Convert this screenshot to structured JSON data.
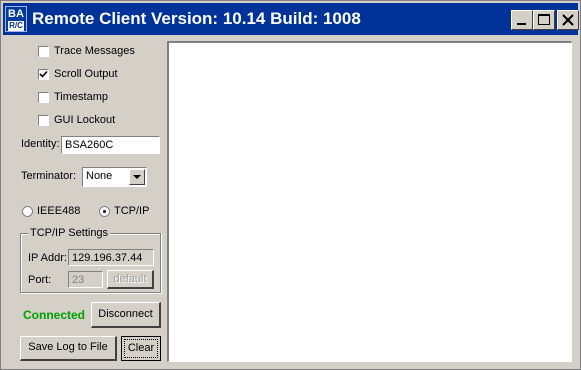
{
  "window": {
    "title": "Remote Client Version: 10.14 Build: 1008",
    "icon": {
      "top": "BA",
      "bottom": "R/C"
    },
    "controls": {
      "minimize": "minimize-icon",
      "maximize": "maximize-icon",
      "close": "close-icon"
    }
  },
  "options": {
    "trace_messages": {
      "label": "Trace Messages",
      "checked": false
    },
    "scroll_output": {
      "label": "Scroll Output",
      "checked": true
    },
    "timestamp": {
      "label": "Timestamp",
      "checked": false
    },
    "gui_lockout": {
      "label": "GUI Lockout",
      "checked": false
    }
  },
  "identity": {
    "label": "Identity:",
    "value": "BSA260C"
  },
  "terminator": {
    "label": "Terminator:",
    "selected": "None"
  },
  "interface": {
    "ieee488": {
      "label": "IEEE488",
      "selected": false
    },
    "tcpip": {
      "label": "TCP/IP",
      "selected": true
    }
  },
  "tcpip_settings": {
    "title": "TCP/IP Settings",
    "ip_label": "IP Addr:",
    "ip_value": "129.196.37.44",
    "port_label": "Port:",
    "port_value": "23",
    "default_label": "default"
  },
  "status": {
    "text": "Connected",
    "color": "#00a000"
  },
  "buttons": {
    "disconnect": "Disconnect",
    "save_log": "Save Log to File",
    "clear": "Clear"
  },
  "colors": {
    "titlebar": "#003399",
    "face": "#d4d0c8"
  }
}
